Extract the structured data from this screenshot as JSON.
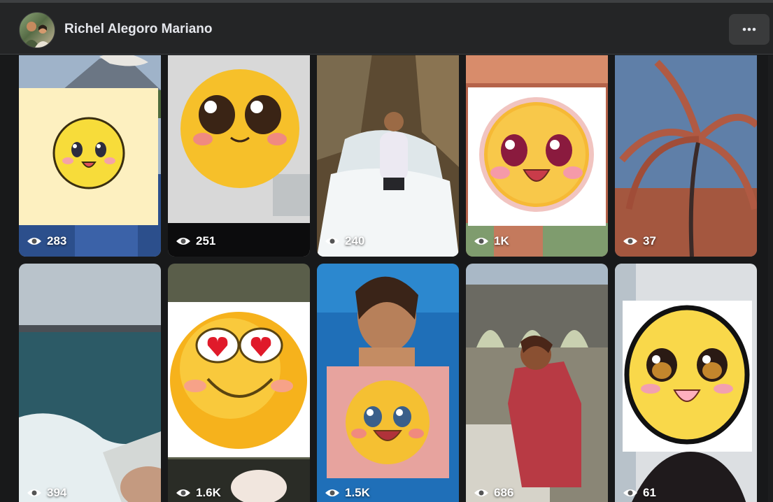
{
  "profile": {
    "name": "Richel Alegoro Mariano"
  },
  "videos": [
    {
      "views": "283"
    },
    {
      "views": "251"
    },
    {
      "views": "240"
    },
    {
      "views": "1K"
    },
    {
      "views": "37"
    },
    {
      "views": "394"
    },
    {
      "views": "1.6K"
    },
    {
      "views": "1.5K"
    },
    {
      "views": "686"
    },
    {
      "views": "61"
    }
  ],
  "icons": {
    "more": "more-horizontal-icon",
    "views": "eye-icon"
  },
  "colors": {
    "background": "#18191a",
    "header": "#242526",
    "button": "#3a3b3c",
    "text": "#e4e6eb"
  }
}
